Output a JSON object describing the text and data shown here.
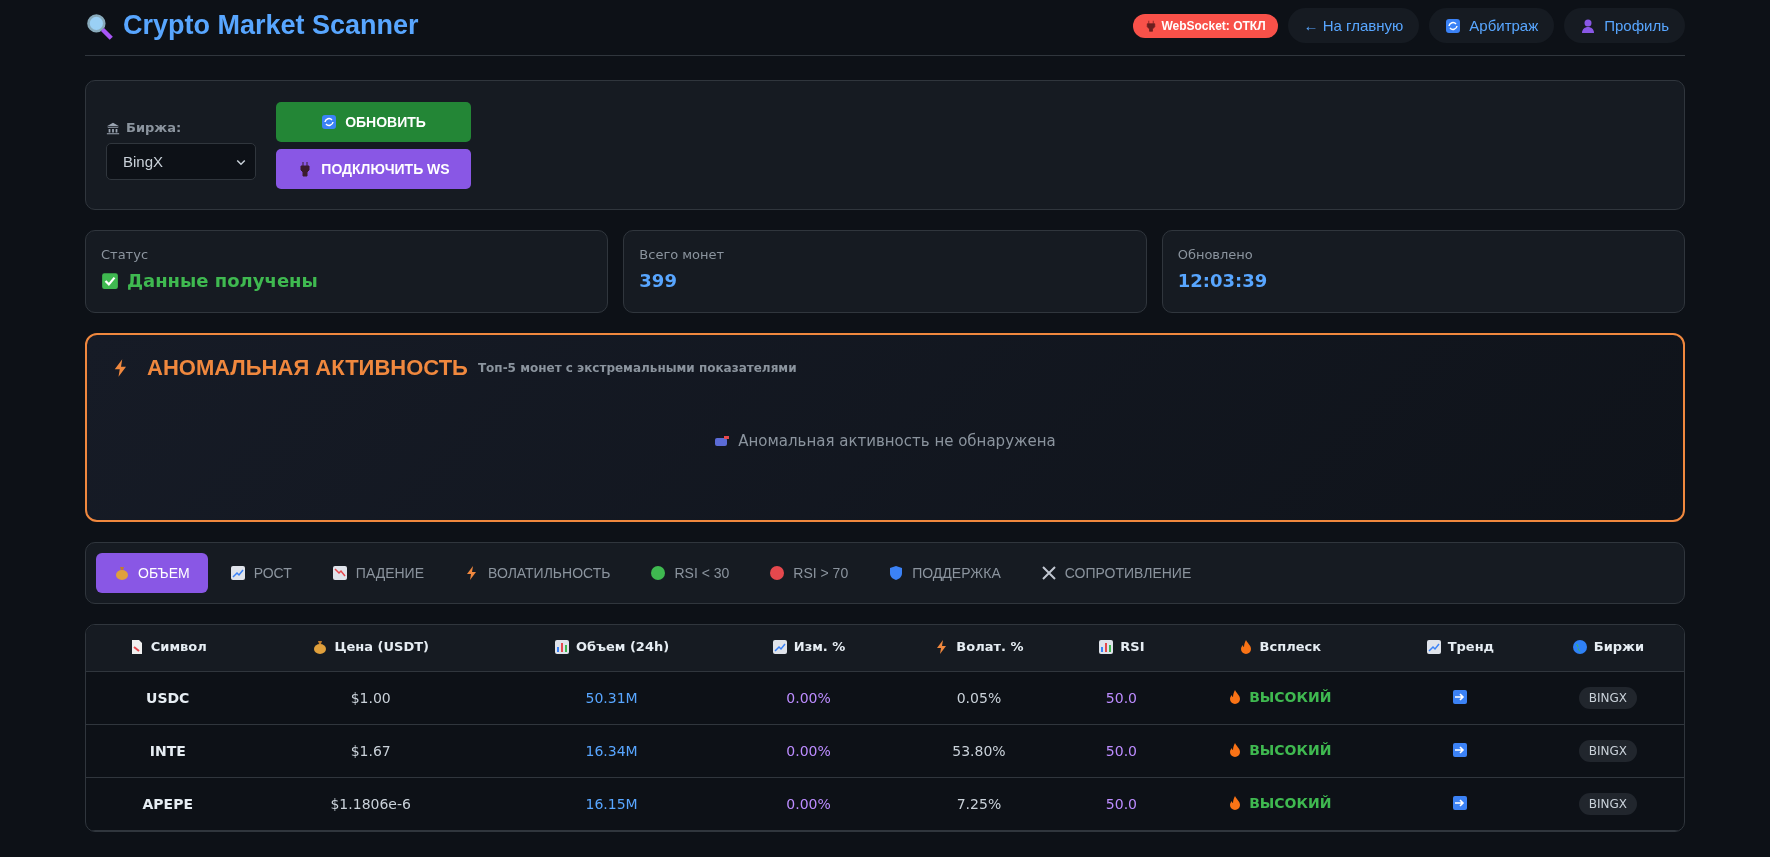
{
  "header": {
    "title": "Crypto Market Scanner",
    "ws_badge": {
      "label": "WebSocket: ОТКЛ",
      "connected": false
    },
    "nav": [
      "← На главную",
      "Арбитраж",
      "Профиль"
    ]
  },
  "controls": {
    "exchange_label": "Биржа:",
    "exchange_value": "BingX",
    "buttons": [
      {
        "label": "ОБНОВИТЬ",
        "kind": "refresh"
      },
      {
        "label": "ПОДКЛЮЧИТЬ WS",
        "kind": "connect"
      }
    ]
  },
  "stats": [
    {
      "label": "Статус",
      "value": "Данные получены",
      "kind": "status"
    },
    {
      "label": "Всего монет",
      "value": "399",
      "kind": "number"
    },
    {
      "label": "Обновлено",
      "value": "12:03:39",
      "kind": "number"
    }
  ],
  "anomaly": {
    "title": "АНОМАЛЬНАЯ АКТИВНОСТЬ",
    "subtitle": "Топ-5 монет с экстремальными показателями",
    "empty": "Аномальная активность не обнаружена"
  },
  "tabs": [
    {
      "label": "ОБЪЕМ",
      "selected": true
    },
    {
      "label": "РОСТ",
      "selected": false
    },
    {
      "label": "ПАДЕНИЕ",
      "selected": false
    },
    {
      "label": "ВОЛАТИЛЬНОСТЬ",
      "selected": false
    },
    {
      "label": "RSI < 30",
      "selected": false
    },
    {
      "label": "RSI > 70",
      "selected": false
    },
    {
      "label": "ПОДДЕРЖКА",
      "selected": false
    },
    {
      "label": "СОПРОТИВЛЕНИЕ",
      "selected": false
    }
  ],
  "table": {
    "columns": [
      "Символ",
      "Цена (USDT)",
      "Объем (24h)",
      "Изм. %",
      "Волат. %",
      "RSI",
      "Всплеск",
      "Тренд",
      "Биржи"
    ],
    "rows": [
      {
        "symbol": "USDC",
        "price": "$1.00",
        "volume": "50.31M",
        "change": "0.00%",
        "volatility": "0.05%",
        "rsi": "50.0",
        "spike": "ВЫСОКИЙ",
        "exchange": "BINGX"
      },
      {
        "symbol": "INTE",
        "price": "$1.67",
        "volume": "16.34M",
        "change": "0.00%",
        "volatility": "53.80%",
        "rsi": "50.0",
        "spike": "ВЫСОКИЙ",
        "exchange": "BINGX"
      },
      {
        "symbol": "APEPE",
        "price": "$1.1806e-6",
        "volume": "16.15M",
        "change": "0.00%",
        "volatility": "7.25%",
        "rsi": "50.0",
        "spike": "ВЫСОКИЙ",
        "exchange": "BINGX"
      }
    ]
  }
}
